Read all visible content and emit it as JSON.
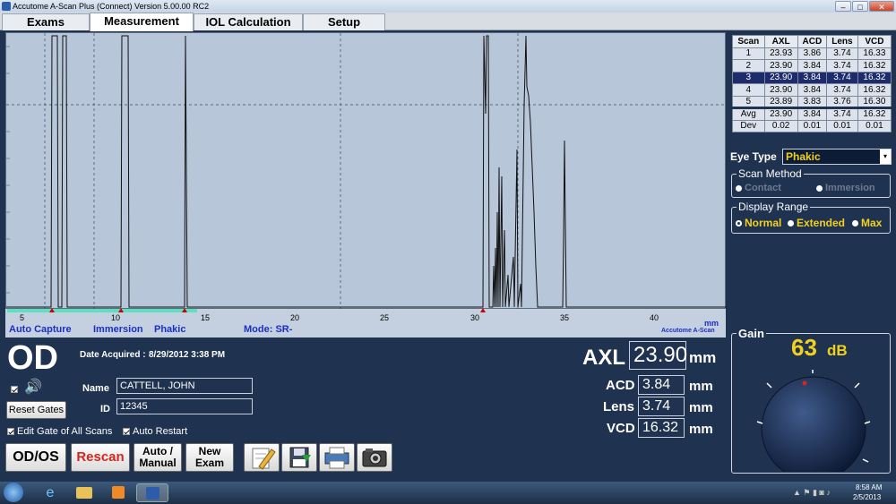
{
  "window": {
    "title": "Accutome A-Scan Plus (Connect) Version 5.00.00 RC2",
    "minimize_icon": "minimize-icon",
    "maximize_icon": "maximize-icon",
    "close_icon": "close-icon"
  },
  "tabs": [
    "Exams",
    "Measurement",
    "IOL Calculation",
    "Setup"
  ],
  "active_tab": "Measurement",
  "graph": {
    "x_ticks": [
      "5",
      "10",
      "15",
      "20",
      "25",
      "30",
      "35",
      "40"
    ],
    "unit": "mm",
    "brand": "Accutome A-Scan",
    "status": {
      "capture": "Auto Capture",
      "method": "Immersion",
      "lens_type": "Phakic",
      "mode": "Mode:  SR-"
    }
  },
  "scan_table": {
    "headers": [
      "Scan",
      "AXL",
      "ACD",
      "Lens",
      "VCD"
    ],
    "rows": [
      [
        "1",
        "23.93",
        "3.86",
        "3.74",
        "16.33"
      ],
      [
        "2",
        "23.90",
        "3.84",
        "3.74",
        "16.32"
      ],
      [
        "3",
        "23.90",
        "3.84",
        "3.74",
        "16.32"
      ],
      [
        "4",
        "23.90",
        "3.84",
        "3.74",
        "16.32"
      ],
      [
        "5",
        "23.89",
        "3.83",
        "3.76",
        "16.30"
      ]
    ],
    "selected_row": 2,
    "summary": [
      [
        "Avg",
        "23.90",
        "3.84",
        "3.74",
        "16.32"
      ],
      [
        "Dev",
        "0.02",
        "0.01",
        "0.01",
        "0.01"
      ]
    ]
  },
  "eye_type": {
    "label": "Eye Type",
    "value": "Phakic"
  },
  "scan_method": {
    "label": "Scan Method",
    "options": [
      "Contact",
      "Immersion"
    ]
  },
  "display_range": {
    "label": "Display Range",
    "options": [
      "Normal",
      "Extended",
      "Max"
    ],
    "selected": "Normal"
  },
  "gain": {
    "label": "Gain",
    "value": "63",
    "unit": "dB"
  },
  "patient": {
    "eye": "OD",
    "date_label": "Date Acquired :",
    "date_value": "8/29/2012 3:38 PM",
    "name_label": "Name",
    "name_value": "CATTELL, JOHN",
    "id_label": "ID",
    "id_value": "12345"
  },
  "measurements": {
    "unit": "mm",
    "axl_label": "AXL",
    "axl": "23.90",
    "acd_label": "ACD",
    "acd": "3.84",
    "lens_label": "Lens",
    "lens": "3.74",
    "vcd_label": "VCD",
    "vcd": "16.32"
  },
  "controls": {
    "reset_gates": "Reset Gates",
    "edit_gate": "Edit Gate of All Scans",
    "auto_restart": "Auto Restart",
    "od_os": "OD/OS",
    "rescan": "Rescan",
    "auto_manual_1": "Auto /",
    "auto_manual_2": "Manual",
    "new_exam_1": "New",
    "new_exam_2": "Exam"
  },
  "taskbar": {
    "time": "8:58 AM",
    "date": "2/5/2013"
  },
  "colors": {
    "panel_bg": "#1f3350",
    "graph_bg": "#b7c6d9",
    "accent_gold": "#f2d01e",
    "status_blue": "#1a2fc8",
    "rescan_red": "#d7261e"
  }
}
